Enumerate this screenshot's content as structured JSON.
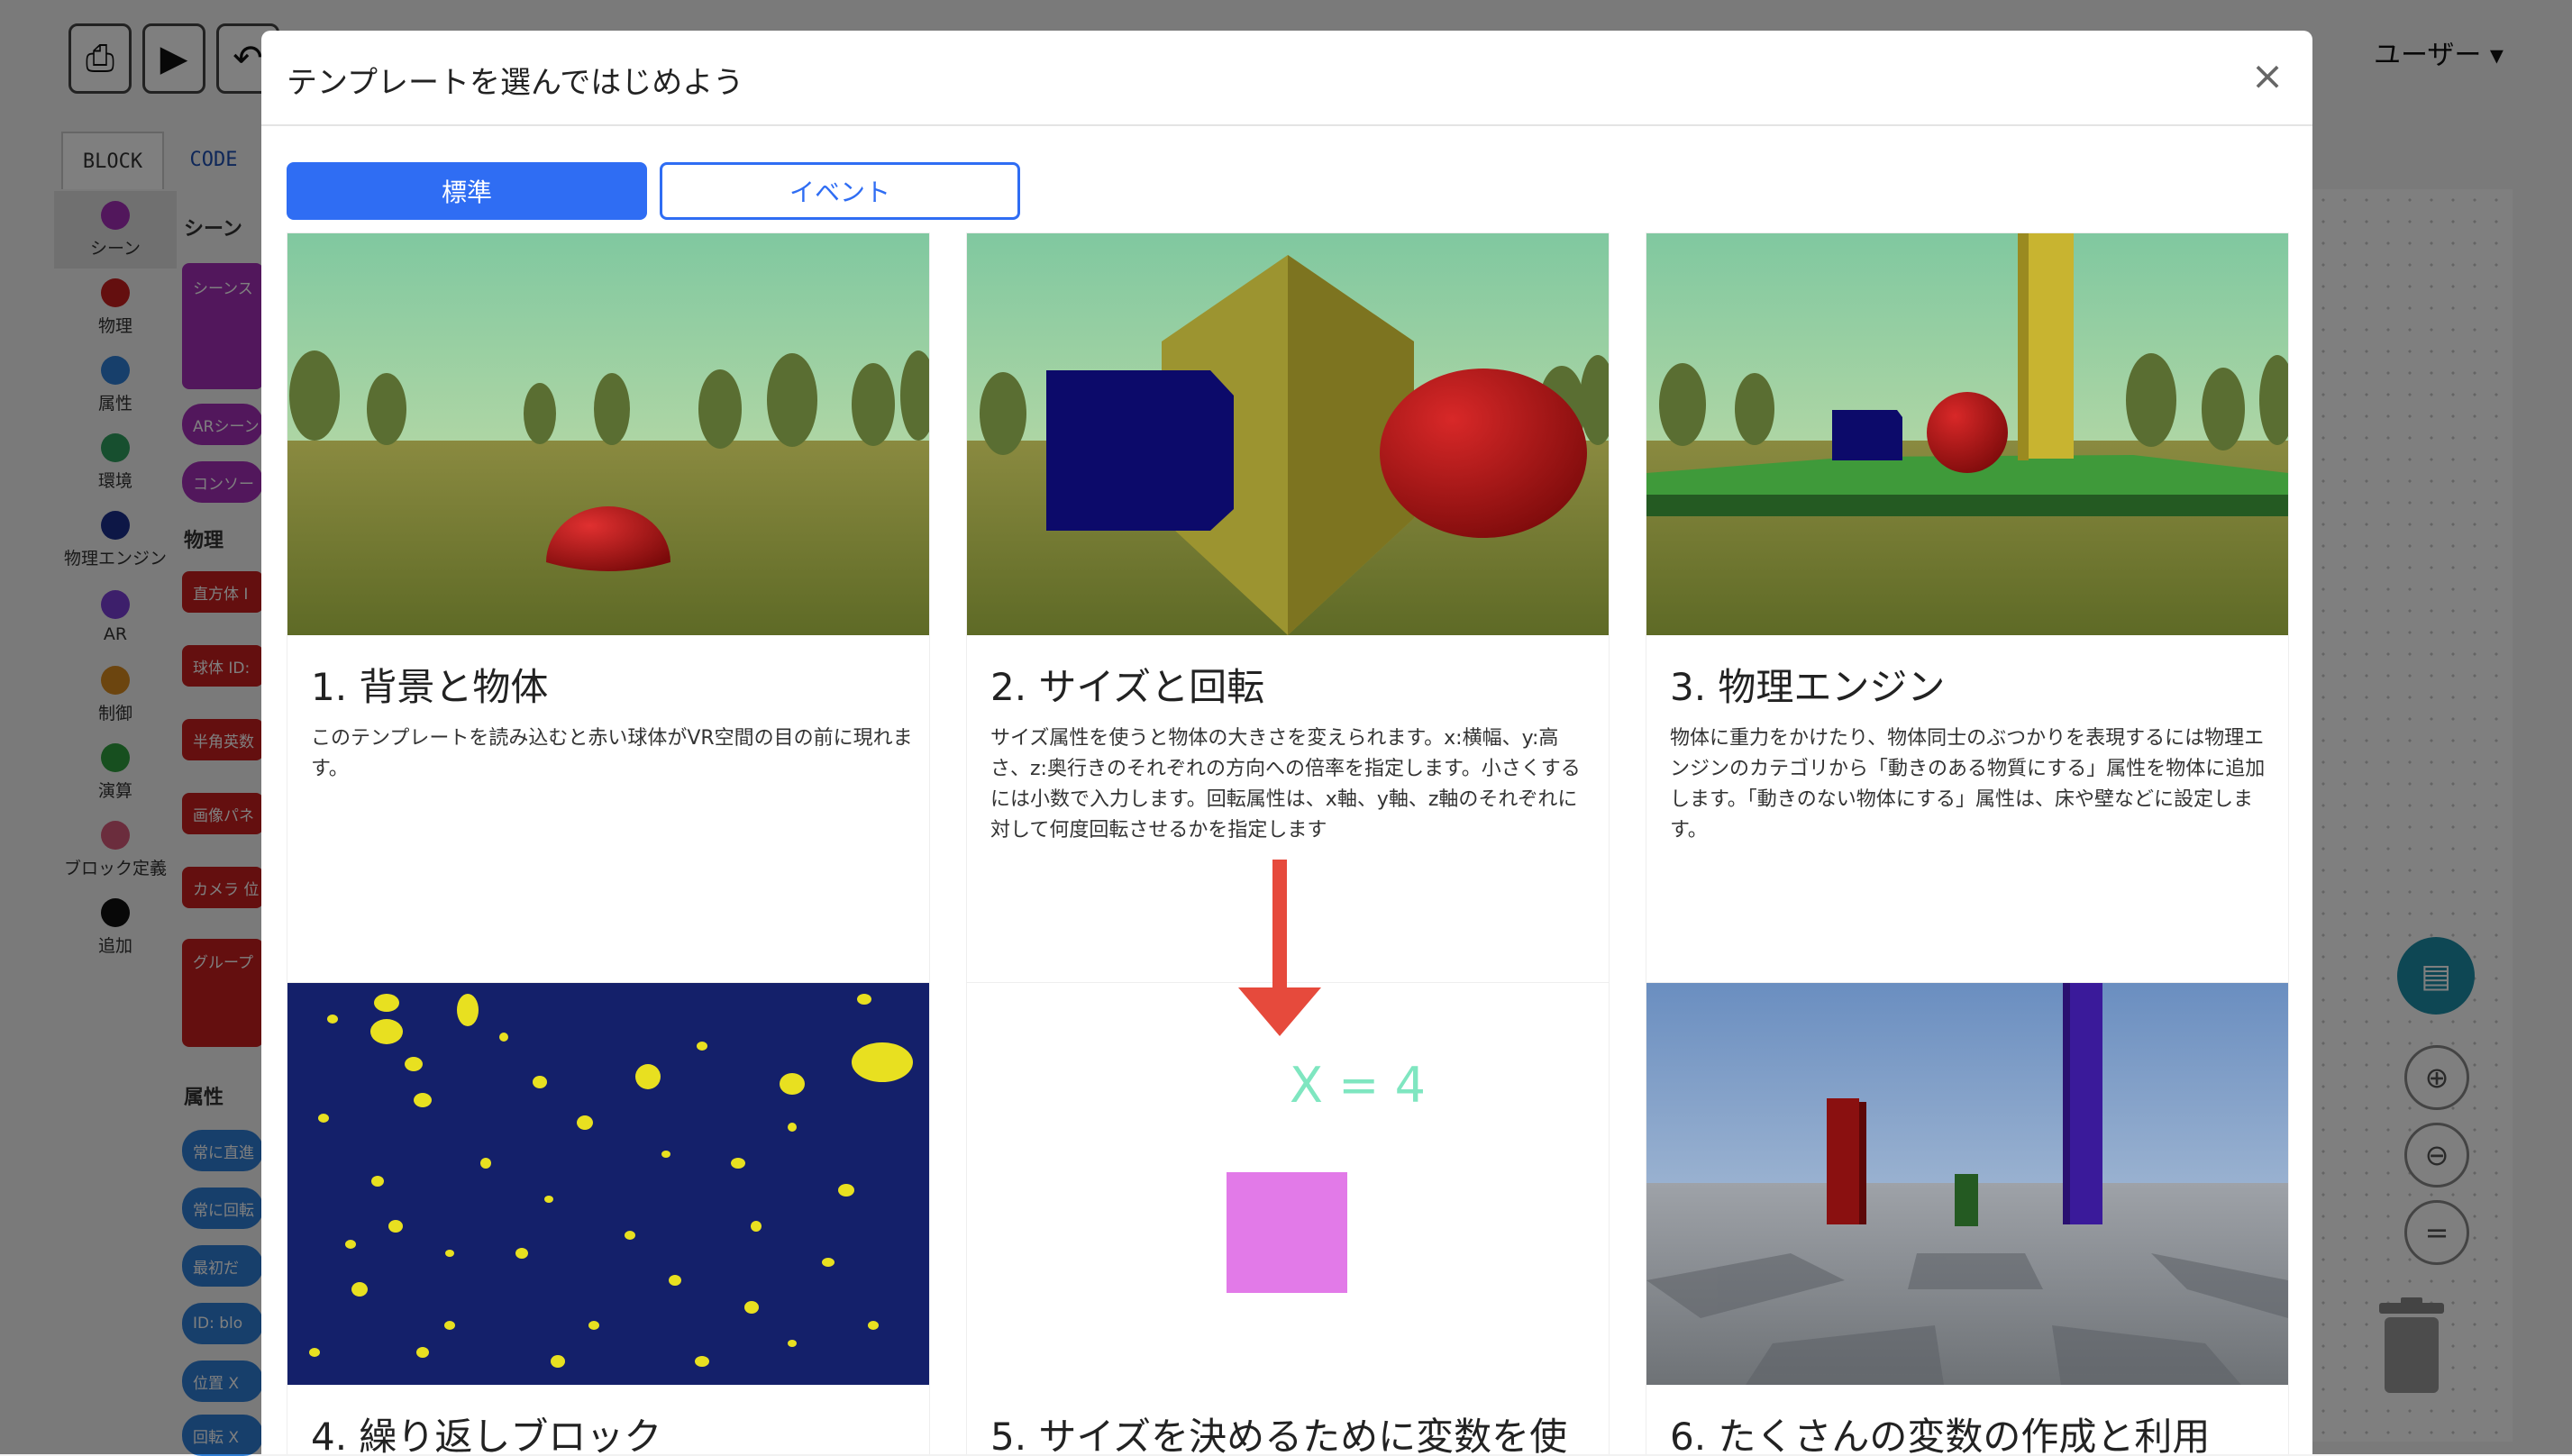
{
  "toolbar": {
    "buttons": [
      "export-icon",
      "play-icon",
      "undo-icon"
    ]
  },
  "user_menu": {
    "label": "ユーザー ▾"
  },
  "left_tabs": [
    {
      "label": "BLOCK"
    },
    {
      "label": "CODE"
    }
  ],
  "categories": [
    {
      "label": "シーン",
      "color": "#a52fb8"
    },
    {
      "label": "物理",
      "color": "#c81e1e"
    },
    {
      "label": "属性",
      "color": "#2f7fd6"
    },
    {
      "label": "環境",
      "color": "#2f9e5e"
    },
    {
      "label": "物理エンジン",
      "color": "#1a2f8c"
    },
    {
      "label": "AR",
      "color": "#7b3fd6"
    },
    {
      "label": "制御",
      "color": "#d98a1e"
    },
    {
      "label": "演算",
      "color": "#2f9e3e"
    },
    {
      "label": "ブロック定義",
      "color": "#d65a7a"
    },
    {
      "label": "追加",
      "color": "#111111"
    }
  ],
  "palette": {
    "scene_header": "シーン",
    "physics_header": "物理",
    "attr_header": "属性",
    "scene_blocks": [
      "シーンス",
      "ARシーン",
      "コンソー"
    ],
    "physics_blocks": [
      "直方体 I",
      "球体 ID:",
      "半角英数",
      "画像パネ",
      "カメラ 位",
      "グループ"
    ],
    "attr_blocks": [
      "常に直進",
      "常に回転",
      "最初だ",
      "ID: blo",
      "位置 X",
      "回転 X"
    ]
  },
  "modal": {
    "title": "テンプレートを選んではじめよう",
    "close_icon": "close-icon",
    "tabs": [
      {
        "label": "標準",
        "active": true
      },
      {
        "label": "イベント",
        "active": false
      }
    ]
  },
  "cards": [
    {
      "title": "1.  背景と物体",
      "desc": "このテンプレートを読み込むと赤い球体がVR空間の目の前に現れます。"
    },
    {
      "title": "2.  サイズと回転",
      "desc": "サイズ属性を使うと物体の大きさを変えられます。x:横幅、y:高さ、z:奥行きのそれぞれの方向への倍率を指定します。小さくするには小数で入力します。回転属性は、x軸、y軸、z軸のそれぞれに対して何度回転させるかを指定します"
    },
    {
      "title": "3.  物理エンジン",
      "desc": "物体に重力をかけたり、物体同士のぶつかりを表現するには物理エンジンのカテゴリから「動きのある物質にする」属性を物体に追加します。「動きのない物体にする」属性は、床や壁などに設定します。"
    },
    {
      "title": "4.  繰り返しブロック",
      "desc": ""
    },
    {
      "title": "5.  サイズを決めるために変数を使",
      "desc": "",
      "image_text": "X = 4"
    },
    {
      "title": "6.  たくさんの変数の作成と利用",
      "desc": ""
    }
  ],
  "colors": {
    "accent": "#2f6df3",
    "close_arrow": "#e64a3c"
  }
}
